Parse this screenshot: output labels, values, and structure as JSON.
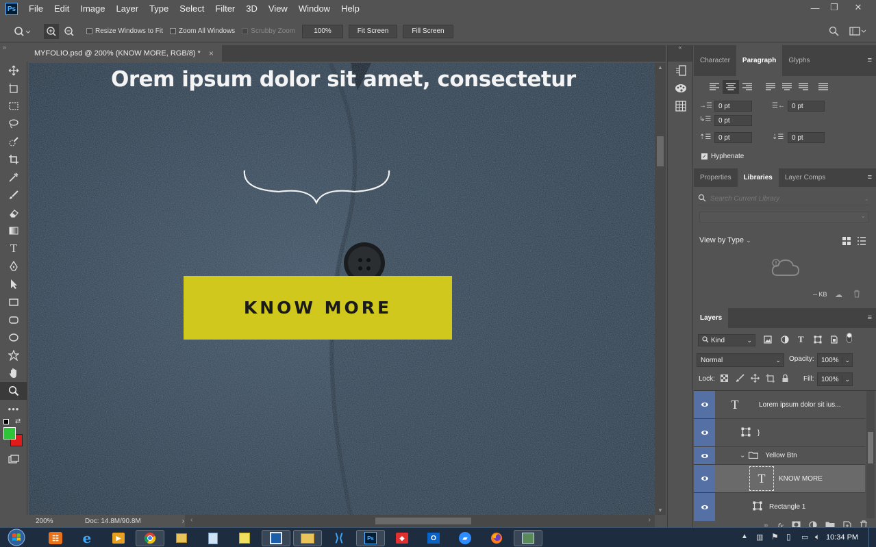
{
  "menubar": {
    "logo": "Ps",
    "items": [
      "File",
      "Edit",
      "Image",
      "Layer",
      "Type",
      "Select",
      "Filter",
      "3D",
      "View",
      "Window",
      "Help"
    ],
    "minimize": "—",
    "restore": "❐",
    "close": "✕"
  },
  "options": {
    "resize_windows": "Resize Windows to Fit",
    "zoom_all": "Zoom All Windows",
    "scrubby": "Scrubby Zoom",
    "zoom_value": "100%",
    "fit_screen": "Fit Screen",
    "fill_screen": "Fill Screen"
  },
  "document": {
    "tab_title": "MYFOLIO.psd @ 200% (KNOW MORE, RGB/8) *",
    "close": "×",
    "headline": "Orem ipsum dolor sit amet, consectetur",
    "button_label": "KNOW MORE",
    "button_color": "#d0c81c"
  },
  "status": {
    "zoom": "200%",
    "doc_size": "Doc: 14.8M/90.8M"
  },
  "tools": [
    "move-icon",
    "artboard-icon",
    "marquee-icon",
    "lasso-icon",
    "quick-select-icon",
    "crop-icon",
    "eyedropper-icon",
    "brush-icon",
    "eraser-icon",
    "gradient-icon",
    "type-icon",
    "pen-icon",
    "path-select-icon",
    "rectangle-icon",
    "rounded-rect-icon",
    "ellipse-icon",
    "custom-shape-icon",
    "hand-icon",
    "zoom-icon",
    "more-tools-icon"
  ],
  "colors": {
    "foreground": "#2ec43a",
    "background": "#e01b1b",
    "selection": "#5470a4"
  },
  "paragraph": {
    "tabs": [
      "Character",
      "Paragraph",
      "Glyphs"
    ],
    "indent_left": "0 pt",
    "indent_right": "0 pt",
    "first_line": "0 pt",
    "space_before": "0 pt",
    "space_after": "0 pt",
    "hyphenate": "Hyphenate"
  },
  "libraries": {
    "tabs": [
      "Properties",
      "Libraries",
      "Layer Comps"
    ],
    "search_placeholder": "Search Current Library",
    "view_by": "View by Type",
    "storage": "-- KB"
  },
  "layers": {
    "tab": "Layers",
    "filter": "Kind",
    "blend_mode": "Normal",
    "opacity_label": "Opacity:",
    "opacity": "100%",
    "lock_label": "Lock:",
    "fill_label": "Fill:",
    "fill": "100%",
    "items": [
      {
        "name": "Lorem ipsum dolor sit ius...",
        "kind": "T"
      },
      {
        "name": "}",
        "kind": "shape"
      },
      {
        "name": "Yellow Btn",
        "kind": "group"
      },
      {
        "name": "KNOW MORE",
        "kind": "T"
      },
      {
        "name": "Rectangle 1",
        "kind": "shape"
      }
    ]
  },
  "taskbar": {
    "time": "10:34 PM"
  }
}
